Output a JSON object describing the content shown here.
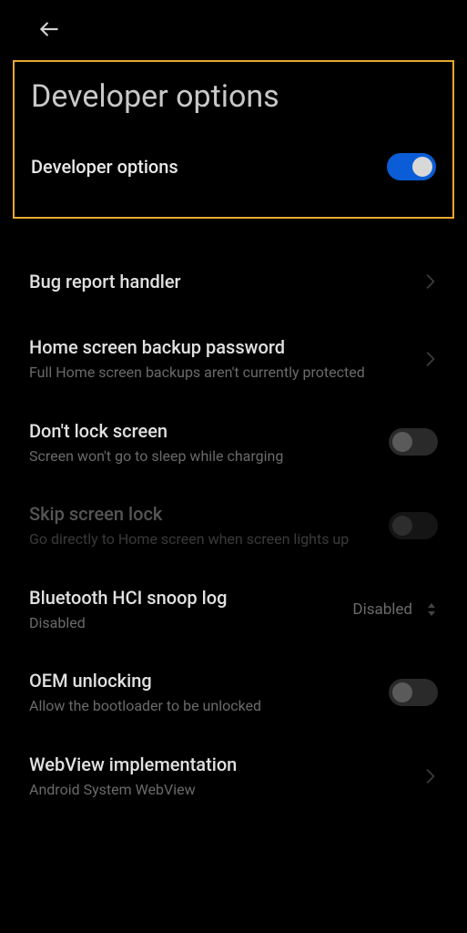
{
  "header": {
    "back_icon": "back"
  },
  "page_title": "Developer options",
  "master_toggle": {
    "label": "Developer options",
    "state": "on"
  },
  "items": [
    {
      "title": "Bug report handler",
      "subtitle": "",
      "control": "chevron"
    },
    {
      "title": "Home screen backup password",
      "subtitle": "Full Home screen backups aren't currently protected",
      "control": "chevron"
    },
    {
      "title": "Don't lock screen",
      "subtitle": "Screen won't go to sleep while charging",
      "control": "toggle-off"
    },
    {
      "title": "Skip screen lock",
      "subtitle": "Go directly to Home screen when screen lights up",
      "control": "toggle-off",
      "disabled": true
    },
    {
      "title": "Bluetooth HCI snoop log",
      "subtitle": "Disabled",
      "control": "dropdown",
      "value": "Disabled"
    },
    {
      "title": "OEM unlocking",
      "subtitle": "Allow the bootloader to be unlocked",
      "control": "toggle-off"
    },
    {
      "title": "WebView implementation",
      "subtitle": "Android System WebView",
      "control": "chevron"
    }
  ]
}
